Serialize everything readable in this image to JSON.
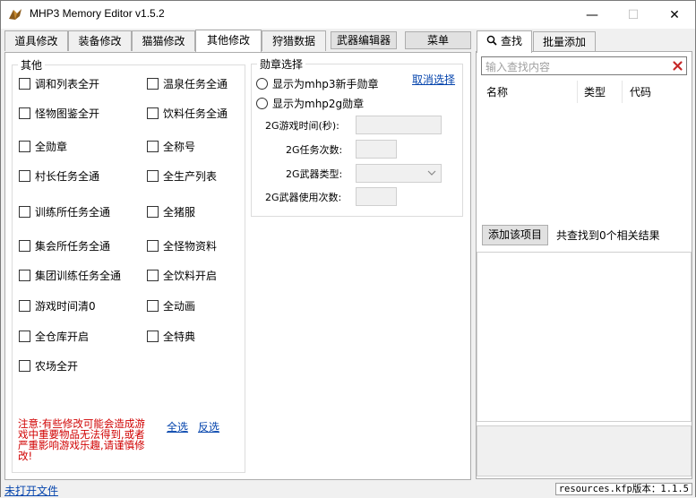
{
  "window": {
    "title": "MHP3 Memory Editor v1.5.2",
    "controls": {
      "minimize": "—",
      "maximize": "☐",
      "close": "✕"
    }
  },
  "left_tabs": [
    {
      "label": "道具修改"
    },
    {
      "label": "装备修改"
    },
    {
      "label": "猫猫修改"
    },
    {
      "label": "其他修改",
      "active": true
    },
    {
      "label": "狩猎数据"
    },
    {
      "label": "武器编辑器"
    },
    {
      "label": "菜单"
    }
  ],
  "other_group": {
    "legend": "其他",
    "col1": [
      "调和列表全开",
      "怪物图鉴全开",
      "全勋章",
      "村长任务全通",
      "训练所任务全通",
      "集会所任务全通",
      "集团训练任务全通",
      "游戏时间清0",
      "全仓库开启",
      "农场全开"
    ],
    "col2": [
      "温泉任务全通",
      "饮料任务全通",
      "全称号",
      "全生产列表",
      "全猪服",
      "全怪物资料",
      "全饮料开启",
      "全动画",
      "全特典"
    ],
    "warning": "注意:有些修改可能会造成游戏中重要物品无法得到,或者严重影响游戏乐趣,请谨慎修改!",
    "select_all": "全选",
    "invert": "反选"
  },
  "medal_group": {
    "legend": "勋章选择",
    "cancel": "取消选择",
    "radio1": "显示为mhp3新手勋章",
    "radio2": "显示为mhp2g勋章",
    "fields": {
      "time": "2G游戏时间(秒):",
      "quests": "2G任务次数:",
      "weapon_type": "2G武器类型:",
      "weapon_uses": "2G武器使用次数:"
    }
  },
  "right_tabs": [
    {
      "label": "查找",
      "icon": "search-icon",
      "active": true
    },
    {
      "label": "批量添加"
    }
  ],
  "search": {
    "placeholder": "输入查找内容",
    "columns": [
      "名称",
      "类型",
      "代码"
    ],
    "add_button": "添加该项目",
    "result_count": "共查找到0个相关结果"
  },
  "status": {
    "file": "未打开文件",
    "version": "resources.kfp版本：1.1.5"
  },
  "colors": {
    "warning": "#d00000",
    "link": "#0645ad",
    "close_x": "#c62828"
  }
}
